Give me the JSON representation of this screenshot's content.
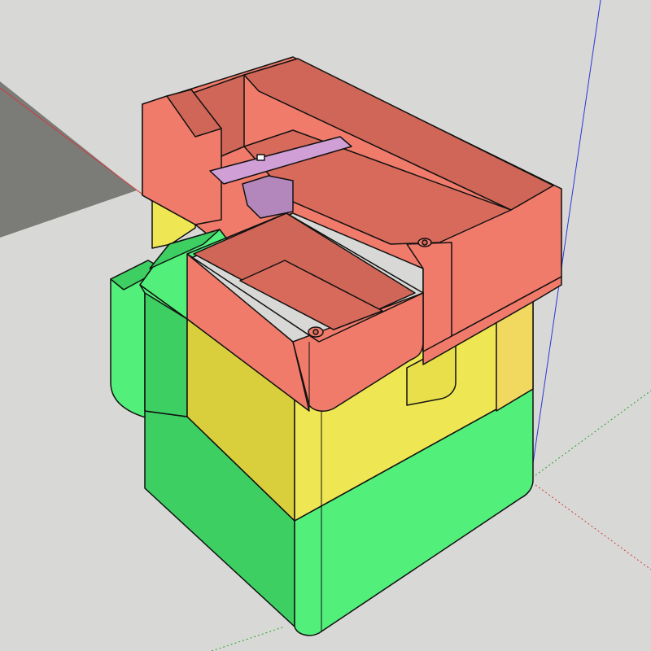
{
  "app": {
    "kind": "3d-modeling-viewport",
    "background": "#d8d9d6",
    "ground_shadow": "#7b7c78"
  },
  "axes": {
    "red": "#d33a3a",
    "green": "#2aa12a",
    "blue": "#2b34d9"
  },
  "model": {
    "name": "stacked-storage-box-assembly",
    "layers": [
      {
        "name": "bottom-tier",
        "color": "#52f07a",
        "shade": "#3ecf62"
      },
      {
        "name": "middle-tier",
        "color": "#efe653",
        "shade": "#d9cf3d"
      },
      {
        "name": "top-tier",
        "color": "#f07b6b",
        "shade": "#cf6657"
      }
    ],
    "handle": {
      "name": "t-shaped-handle",
      "color": "#cf9fd6",
      "shade": "#b487bc"
    }
  }
}
